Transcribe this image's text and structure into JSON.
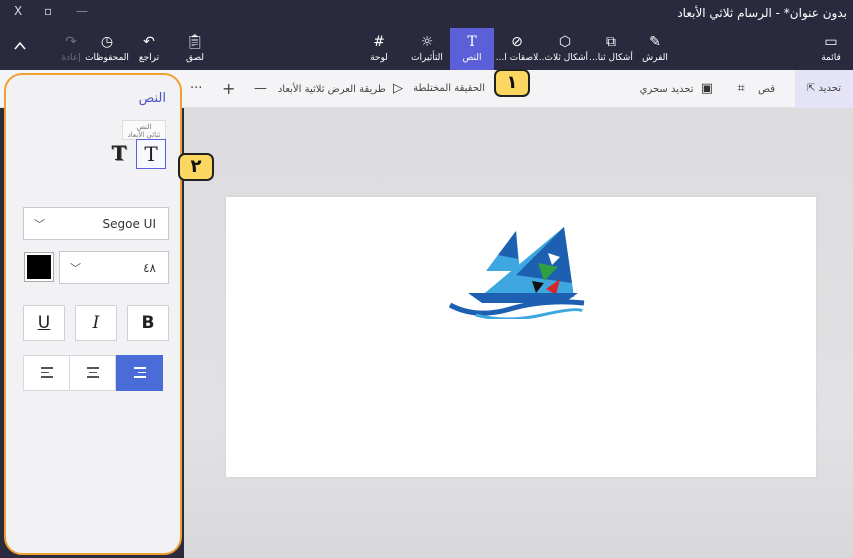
{
  "window": {
    "title": "بدون عنوان* - الرسام ثلاثي الأبعاد",
    "close_glyph": "X",
    "restore_glyph": "▫",
    "minimize_glyph": "—"
  },
  "ribbon": {
    "menu_label": "قائمة",
    "items": [
      {
        "label": "قائمة"
      },
      {
        "label": "الفرش"
      },
      {
        "label": "أشكال ثنا..."
      },
      {
        "label": "أشكال ثلاث..."
      },
      {
        "label": "لاصقات ا..."
      },
      {
        "label": "النص"
      },
      {
        "label": "التأثيرات"
      },
      {
        "label": "لوحة"
      },
      {
        "label": "لصق"
      },
      {
        "label": "تراجع"
      },
      {
        "label": "المحفوظات"
      },
      {
        "label": "إعادة"
      }
    ],
    "active": "النص",
    "collapse_glyph": "^"
  },
  "toolbar": {
    "select_label": "تحديد",
    "crop_label": "قص",
    "magic_select_label": "تحديد سحري",
    "mixed_reality_label": "الحقيقة المختلطة",
    "view_3d_label": "طريقة العرض ثلاثية الأبعاد",
    "zoom_out_glyph": "—",
    "zoom_in_glyph": "+",
    "more_glyph": "···"
  },
  "callouts": {
    "one": "١",
    "two": "٢"
  },
  "panel": {
    "title": "النص",
    "tooltip_line1": "النص",
    "tooltip_line2": "ثنائي الأبعاد",
    "text_2d_glyph": "T",
    "text_3d_glyph": "T",
    "font_family": "Segoe UI",
    "font_size": "٤٨",
    "font_color": "#000000",
    "underline_glyph": "U",
    "italic_glyph": "I",
    "bold_glyph": "B",
    "alignment_active": "right"
  },
  "canvas": {
    "background": "#ffffff"
  },
  "logo": {
    "colors": {
      "blue_dark": "#1d5fb0",
      "blue_light": "#3fa7e0",
      "green": "#2ea043",
      "red": "#d62828",
      "black": "#111111"
    }
  }
}
